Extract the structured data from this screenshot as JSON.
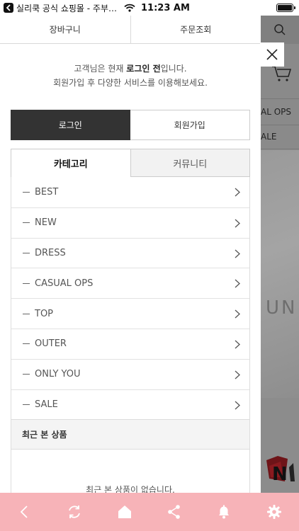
{
  "status_bar": {
    "app_name": "실리쿡 공식 쇼핑몰 - 주부…",
    "time": "11:23 AM"
  },
  "background_page": {
    "nav_item_1": "AL OPS",
    "nav_item_2": "ALE",
    "photo_text": "UN"
  },
  "drawer": {
    "top_links": {
      "cart": "장바구니",
      "order_lookup": "주문조회"
    },
    "welcome": {
      "line1_before": "고객님은 현재 ",
      "line1_bold": "로그인 전",
      "line1_after": "입니다.",
      "line2": "회원가입 후 다양한 서비스를 이용해보세요."
    },
    "auth": {
      "login": "로그인",
      "join": "회원가입"
    },
    "tabs": {
      "category": "카테고리",
      "community": "커뮤니티"
    },
    "categories": [
      "BEST",
      "NEW",
      "DRESS",
      "CASUAL OPS",
      "TOP",
      "OUTER",
      "ONLY YOU",
      "SALE"
    ],
    "recent": {
      "title": "최근 본 상품",
      "empty_message": "최근 본 상품이 없습니다."
    }
  },
  "toolbar": {
    "icons": [
      "back-icon",
      "refresh-icon",
      "home-icon",
      "share-icon",
      "bell-icon",
      "gear-icon"
    ],
    "background_color": "#f7b3b8"
  }
}
